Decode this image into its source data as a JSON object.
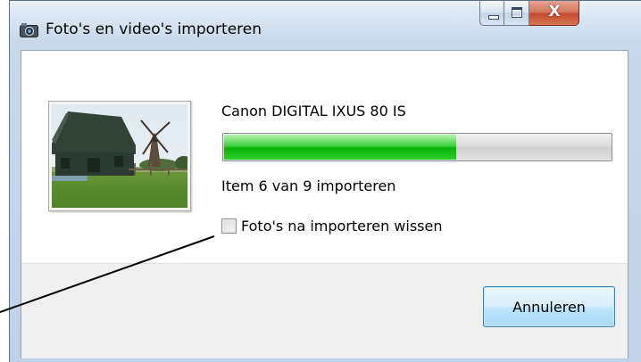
{
  "window": {
    "title": "Foto's en video's importeren",
    "icon": "camera-import-icon",
    "caption_buttons": {
      "minimize_icon": "minimize-icon",
      "maximize_icon": "maximize-icon",
      "close_label": "X"
    }
  },
  "import": {
    "device_name": "Canon DIGITAL IXUS 80 IS",
    "progress_fraction": 0.6,
    "status": "Item 6 van 9 importeren",
    "delete_after_import_label": "Foto's na importeren wissen",
    "delete_after_import_checked": false,
    "cancel_label": "Annuleren"
  },
  "colors": {
    "progress_fill": "#08b108",
    "close_button": "#c2472d",
    "cancel_border": "#3c7fb1"
  }
}
